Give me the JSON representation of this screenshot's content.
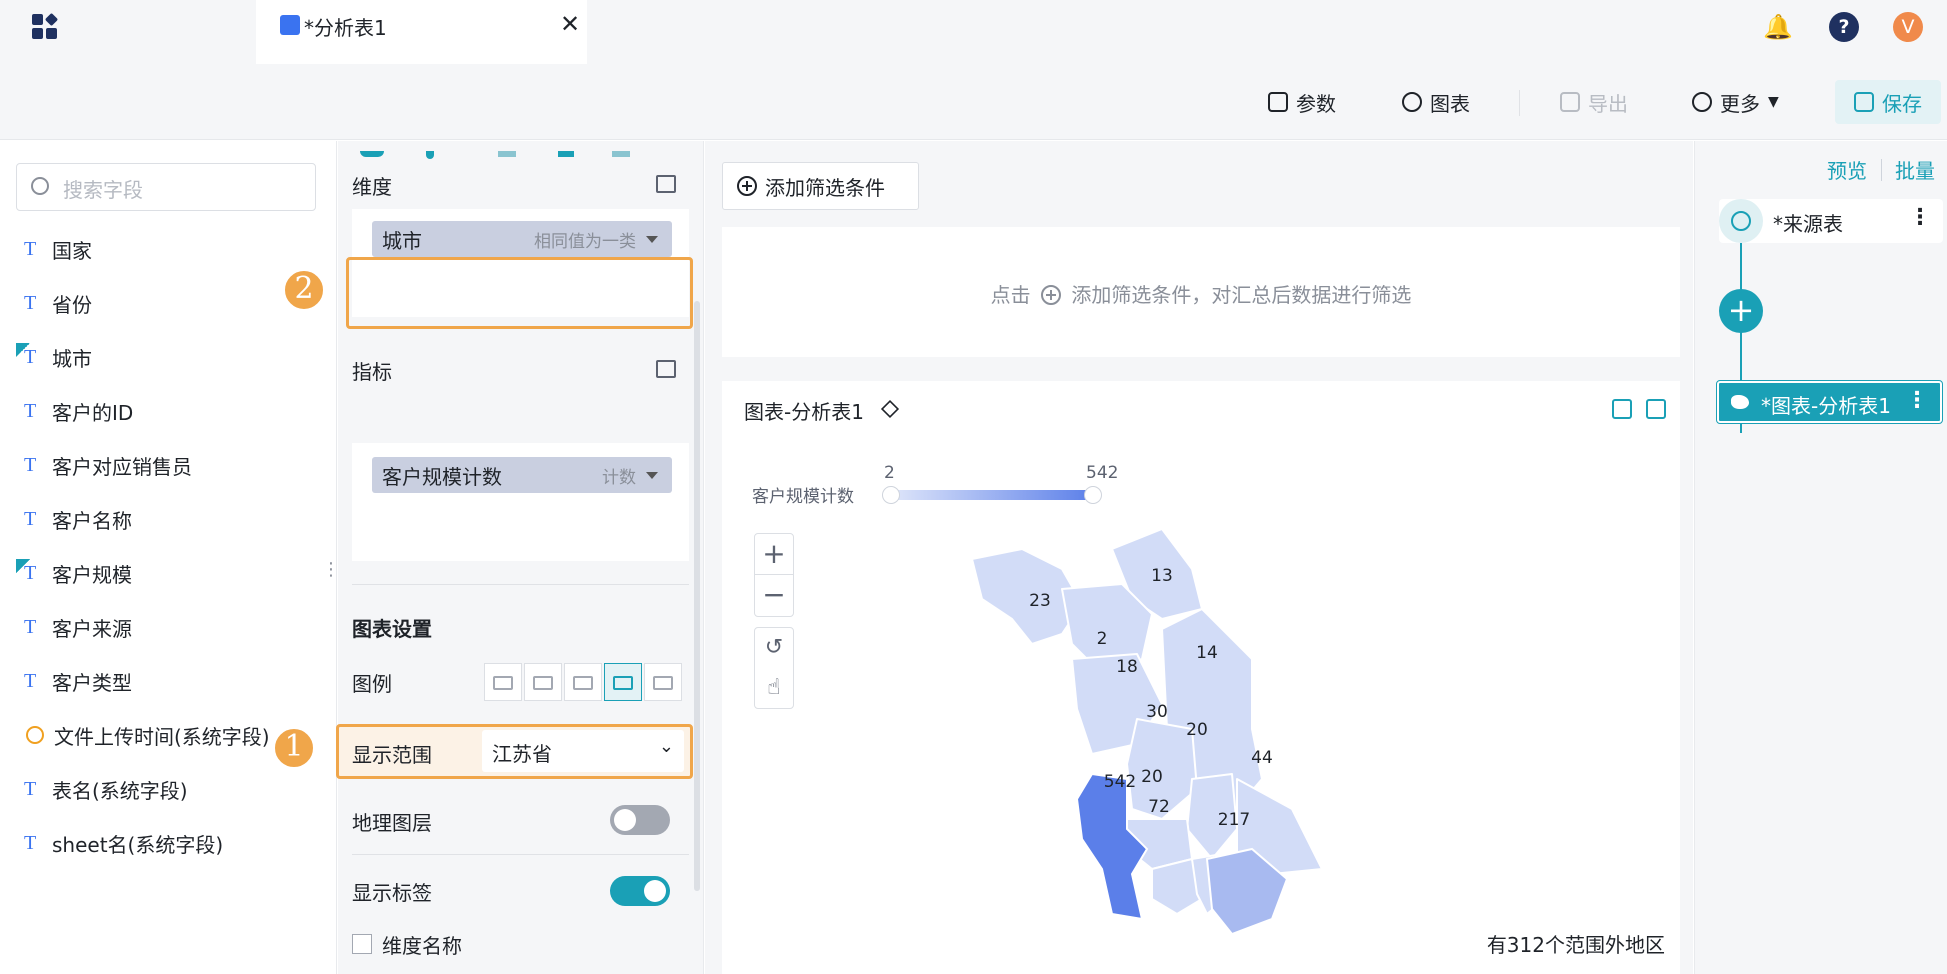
{
  "tab": {
    "title": "*分析表1",
    "close": "✕"
  },
  "topbar": {
    "help": "?",
    "user_initial": "V",
    "user_color": "#f08a4b"
  },
  "toolbar": {
    "params": "参数",
    "chart": "图表",
    "export": "导出",
    "more": "更多",
    "save": "保存"
  },
  "fields": {
    "search_placeholder": "搜索字段",
    "items": [
      {
        "label": "国家",
        "icon": "text-type-icon"
      },
      {
        "label": "省份",
        "icon": "text-type-icon"
      },
      {
        "label": "城市",
        "icon": "text-type-icon"
      },
      {
        "label": "客户的ID",
        "icon": "text-type-icon"
      },
      {
        "label": "客户对应销售员",
        "icon": "text-type-icon"
      },
      {
        "label": "客户名称",
        "icon": "text-type-icon"
      },
      {
        "label": "客户规模",
        "icon": "text-type-icon"
      },
      {
        "label": "客户来源",
        "icon": "text-type-icon"
      },
      {
        "label": "客户类型",
        "icon": "text-type-icon"
      },
      {
        "label": "文件上传时间(系统字段)",
        "icon": "clock-icon"
      },
      {
        "label": "表名(系统字段)",
        "icon": "text-type-icon"
      },
      {
        "label": "sheet名(系统字段)",
        "icon": "text-type-icon"
      }
    ]
  },
  "config": {
    "dimension_title": "维度",
    "dimension_pill": {
      "label": "城市",
      "agg": "相同值为一类"
    },
    "metric_title": "指标",
    "metric_pill": {
      "label": "客户规模计数",
      "agg": "计数"
    },
    "chart_settings_title": "图表设置",
    "legend_label": "图例",
    "range_label": "显示范围",
    "range_value": "江苏省",
    "geo_layer_label": "地理图层",
    "geo_layer_on": false,
    "show_labels_label": "显示标签",
    "show_labels_on": true,
    "dim_name_label": "维度名称",
    "badge_1": "1",
    "badge_2": "2"
  },
  "main": {
    "add_filter": "添加筛选条件",
    "filter_hint_prefix": "点击",
    "filter_hint_suffix": "添加筛选条件，对汇总后数据进行筛选",
    "chart_title": "图表-分析表1",
    "visualmap_label": "客户规模计数",
    "visualmap_min": "2",
    "visualmap_max": "542",
    "zoom_in": "+",
    "zoom_out": "−",
    "reset": "↺",
    "pan": "☝",
    "outside_note": "有312个范围外地区",
    "region_labels": [
      "13",
      "23",
      "2",
      "18",
      "14",
      "30",
      "20",
      "44",
      "542",
      "20",
      "72",
      "217"
    ]
  },
  "flow": {
    "preview": "预览",
    "batch": "批量",
    "source_node": "*来源表",
    "add": "+",
    "chart_node": "*图表-分析表1",
    "menu": "⋮"
  },
  "colors": {
    "accent": "#1aa0b6",
    "highlight": "#f0a64a",
    "map_max": "#5b7fe9",
    "map_min": "#dfe6fa"
  }
}
